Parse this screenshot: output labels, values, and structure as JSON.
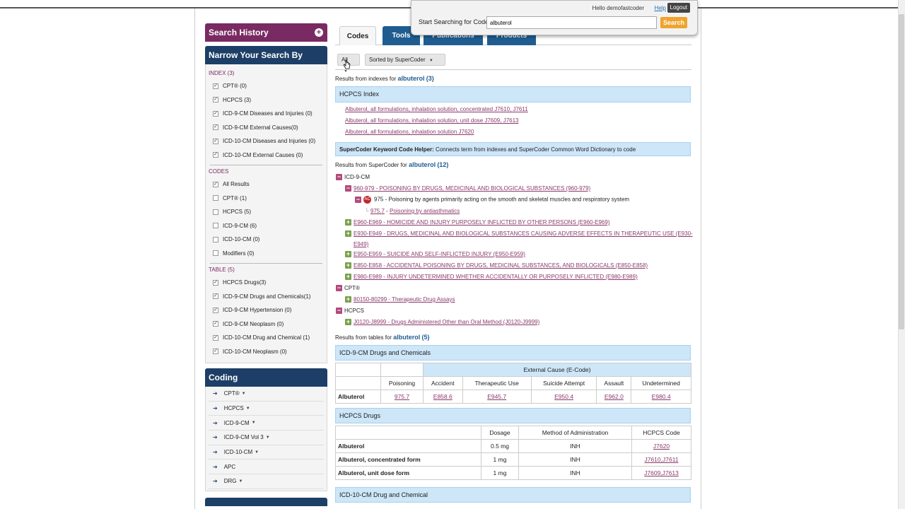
{
  "header": {
    "greeting": "Hello demofastcoder",
    "help": "Help",
    "logout": "Logout",
    "search_label": "Start Searching for Codes",
    "search_value": "albuterol",
    "search_button": "Search"
  },
  "tabs": [
    {
      "label": "Codes"
    },
    {
      "label": "Tools"
    },
    {
      "label": "Publications"
    },
    {
      "label": "Products"
    }
  ],
  "sidebar": {
    "search_history": "Search History",
    "narrow": "Narrow Your Search By",
    "index_title": "INDEX (3)",
    "index_items": [
      "CPT® (0)",
      "HCPCS (3)",
      "ICD-9-CM Diseases and Injuries (0)",
      "ICD-9-CM External Causes(0)",
      "ICD-10-CM Diseases and Injuries (0)",
      "ICD-10-CM External Causes (0)"
    ],
    "codes_title": "CODES",
    "codes_items": [
      "All Results",
      "CPT® (1)",
      "HCPCS (5)",
      "ICD-9-CM (6)",
      "ICD-10-CM (0)",
      "Modifiers (0)"
    ],
    "table_title": "TABLE (5)",
    "table_items": [
      "HCPCS Drugs(3)",
      "ICD-9-CM Drugs and Chemicals(1)",
      "ICD-9-CM Hypertension (0)",
      "ICD-9-CM Neoplasm (0)",
      "ICD-10-CM Drug and Chemical (1)",
      "ICD-10-CM Neoplasm (0)"
    ],
    "coding_title": "Coding",
    "coding_items": [
      "CPT®",
      "HCPCS",
      "ICD-9-CM",
      "ICD-9-CM Vol 3",
      "ICD-10-CM",
      "APC",
      "DRG"
    ]
  },
  "filters": {
    "all": "All",
    "sort": "Sorted by SuperCoder"
  },
  "results": {
    "index_prefix": "Results from indexes for",
    "term": "albuterol",
    "index_count": "(3)",
    "hcpcs_index": "HCPCS Index",
    "index_links": [
      "Albuterol, all formulations, inhalation solution, concentrated J7610, J7611",
      "Albuterol, all formulations, inhalation solution, unit dose J7609, J7613",
      "Albuterol, all formulations, inhalation solution J7620"
    ],
    "helper_bold": "SuperCoder Keyword Code Helper:",
    "helper_text": "Connects term from indexes and SuperCoder Common Word Dictionary to code",
    "supercoder_prefix": "Results from SuperCoder for",
    "supercoder_count": "(12)",
    "tree": {
      "icd9": "ICD-9-CM",
      "n1": "960-979 - POISONING BY DRUGS, MEDICINAL AND BIOLOGICAL SUBSTANCES (960-979)",
      "n2_code": "975",
      "n2_text": "Poisoning by agents primarily acting on the smooth and skeletal muscles and respiratory system",
      "n3_code": "975.7",
      "n3_text": "Poisoning by antiasthmatics",
      "n4": "E960-E969 - HOMICIDE AND INJURY PURPOSELY INFLICTED BY OTHER PERSONS (E960-E969)",
      "n5a": "E930-E949 - DRUGS, MEDICINAL AND BIOLOGICAL SUBSTANCES CAUSING ADVERSE EFFECTS IN THERAPEUTIC USE (E930-",
      "n5b": "E949)",
      "n6": "E950-E959 - SUICIDE AND SELF-INFLICTED INJURY (E950-E959)",
      "n7": "E850-E858 - ACCIDENTAL POISONING BY DRUGS, MEDICINAL SUBSTANCES, AND BIOLOGICALS (E850-E858)",
      "n8": "E980-E989 - INJURY UNDETERMINED WHETHER ACCIDENTALLY OR PURPOSELY INFLICTED (E980-E989)",
      "cpt": "CPT®",
      "cpt1": "80150-80299 - Therapeutic Drug Assays",
      "hcpcs": "HCPCS",
      "hcpcs1": "J0120-J8999 - Drugs Administered Other than Oral Method (J0120-J9999)",
      "mod_icon": "AC"
    },
    "tables_prefix": "Results from tables for",
    "tables_count": "(5)",
    "icd9_drugs_title": "ICD-9-CM Drugs and Chemicals",
    "icd9_table": {
      "group_header": "External Cause (E-Code)",
      "headers": [
        "Poisoning",
        "Accident",
        "Therapeutic Use",
        "Suicide Attempt",
        "Assault",
        "Undetermined"
      ],
      "row_label": "Albuterol",
      "cells": [
        "975.7",
        "E858.6",
        "E945.7",
        "E950.4",
        "E962.0",
        "E980.4"
      ]
    },
    "hcpcs_drugs_title": "HCPCS Drugs",
    "hcpcs_table": {
      "headers": [
        "Dosage",
        "Method of Administration",
        "HCPCS Code"
      ],
      "rows": [
        {
          "label": "Albuterol",
          "dosage": "0.5 mg",
          "method": "INH",
          "code": "J7620"
        },
        {
          "label": "Albuterol, concentrated form",
          "dosage": "1 mg",
          "method": "INH",
          "code": "J7610,J7611"
        },
        {
          "label": "Albuterol, unit dose form",
          "dosage": "1 mg",
          "method": "INH",
          "code": "J7609,J7613"
        }
      ]
    },
    "icd10_drug_title": "ICD-10-CM Drug and Chemical"
  },
  "colors": {
    "purple": "#7a2a62",
    "navy": "#1d3f67",
    "tab_blue": "#1f5d90",
    "light_blue": "#cde6f8",
    "orange": "#f0a32d"
  }
}
